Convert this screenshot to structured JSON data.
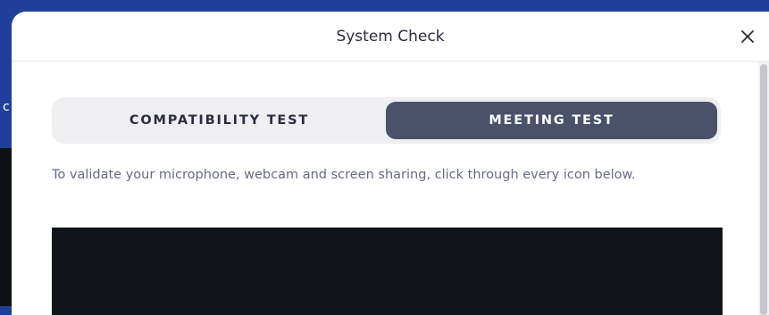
{
  "backdrop": {
    "edge_glyph": "c"
  },
  "dialog": {
    "title": "System Check",
    "close_icon": "close-icon"
  },
  "tabs": [
    {
      "label": "COMPATIBILITY TEST",
      "active": false
    },
    {
      "label": "MEETING TEST",
      "active": true
    }
  ],
  "instructions": "To validate your microphone, webcam and screen sharing, click through every icon below.",
  "colors": {
    "backdrop": "#1f3f9a",
    "active_tab": "#4b5169",
    "tab_bar": "#efeff2",
    "video_preview": "#111519"
  }
}
